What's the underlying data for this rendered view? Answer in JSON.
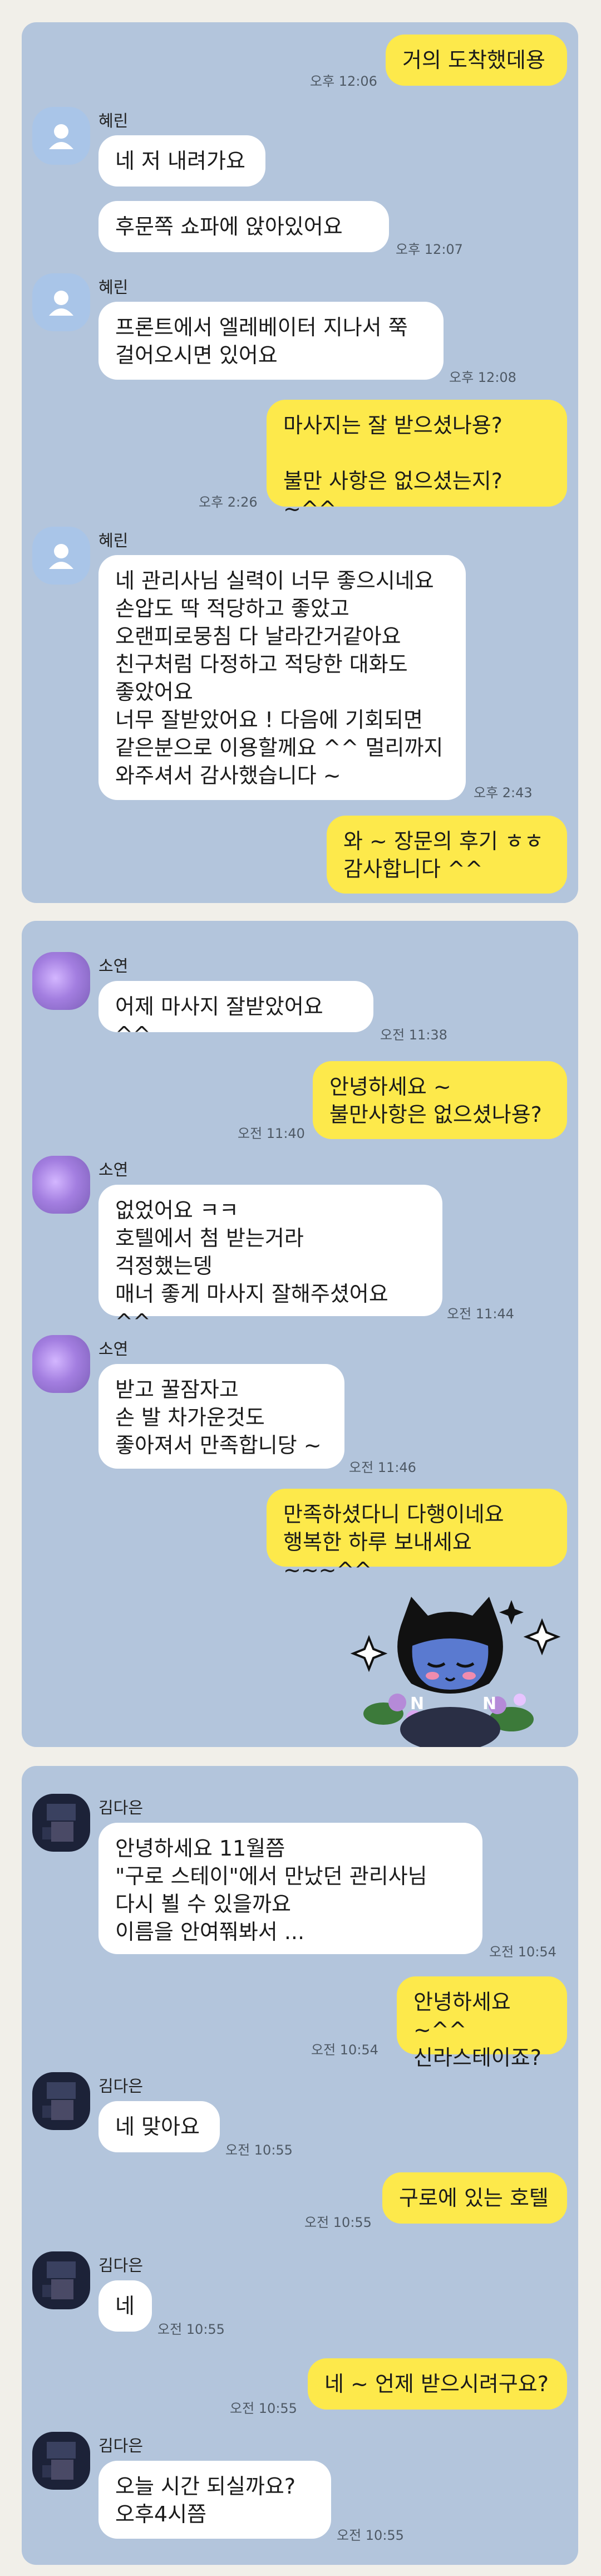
{
  "conversations": [
    {
      "messages": [
        {
          "text": "거의 도착했데용",
          "time": "오후 12:06"
        },
        {
          "sender": "혜린",
          "text": "네 저 내려가요"
        },
        {
          "text": "후문쪽 쇼파에 앉아있어요",
          "time": "오후 12:07"
        },
        {
          "sender": "혜린",
          "text": "프론트에서 엘레베이터 지나서 쭉\n걸어오시면 있어요",
          "time": "오후 12:08"
        },
        {
          "text": "마사지는 잘 받으셨나용?\n\n불만 사항은 없으셨는지? ~^^",
          "time": "오후 2:26"
        },
        {
          "sender": "혜린",
          "text": "네 관리사님 실력이 너무 좋으시네요\n손압도 딱 적당하고 좋았고\n오랜피로뭉침 다 날라간거같아요\n친구처럼 다정하고 적당한 대화도\n좋았어요\n너무 잘받았어요 ! 다음에 기회되면\n같은분으로 이용할께요 ^^ 멀리까지\n와주셔서 감사했습니다 ~",
          "time": "오후 2:43"
        },
        {
          "text": "와 ~ 장문의 후기 ㅎㅎ\n감사합니다 ^^"
        }
      ]
    },
    {
      "messages": [
        {
          "sender": "소연",
          "text": "어제 마사지 잘받았어요 ^^",
          "time": "오전 11:38"
        },
        {
          "text": "안녕하세요 ~\n불만사항은 없으셨나용?",
          "time": "오전 11:40"
        },
        {
          "sender": "소연",
          "text": "없었어요 ㅋㅋ\n호텔에서 첨 받는거라\n걱정했는뎅\n매너 좋게 마사지 잘해주셨어요 ^^",
          "time": "오전 11:44"
        },
        {
          "sender": "소연",
          "text": "받고 꿀잠자고\n손 발 차가운것도\n좋아져서 만족합니당 ~",
          "time": "오전 11:46"
        },
        {
          "text": "만족하셨다니 다행이네요\n행복한 하루 보내세요 ~~~^^"
        }
      ]
    },
    {
      "messages": [
        {
          "sender": "김다은",
          "text": "안녕하세요 11월쯤\n\"구로 스테이\"에서 만났던 관리사님\n다시 뵐 수 있을까요\n이름을 안여쭤봐서 ...",
          "time": "오전 10:54"
        },
        {
          "text": "안녕하세요 ~^^\n신라스테이죠?",
          "time": "오전 10:54"
        },
        {
          "sender": "김다은",
          "text": "네 맞아요",
          "time": "오전 10:55"
        },
        {
          "text": "구로에 있는 호텔",
          "time": "오전 10:55"
        },
        {
          "sender": "김다은",
          "text": "네",
          "time": "오전 10:55"
        },
        {
          "text": "네 ~ 언제 받으시려구요?",
          "time": "오전 10:55"
        },
        {
          "sender": "김다은",
          "text": "오늘  시간 되실까요?\n오후4시쯤",
          "time": "오전 10:55"
        }
      ]
    }
  ],
  "colors": {
    "page_bg": "#f1efe9",
    "panel_bg": "#b3c5dc",
    "incoming_bubble": "#ffffff",
    "outgoing_bubble": "#fde94b",
    "timestamp": "#4e5965"
  },
  "icons": {
    "default_avatar": "person-silhouette-icon",
    "sticker": "cat-character-sticker"
  }
}
